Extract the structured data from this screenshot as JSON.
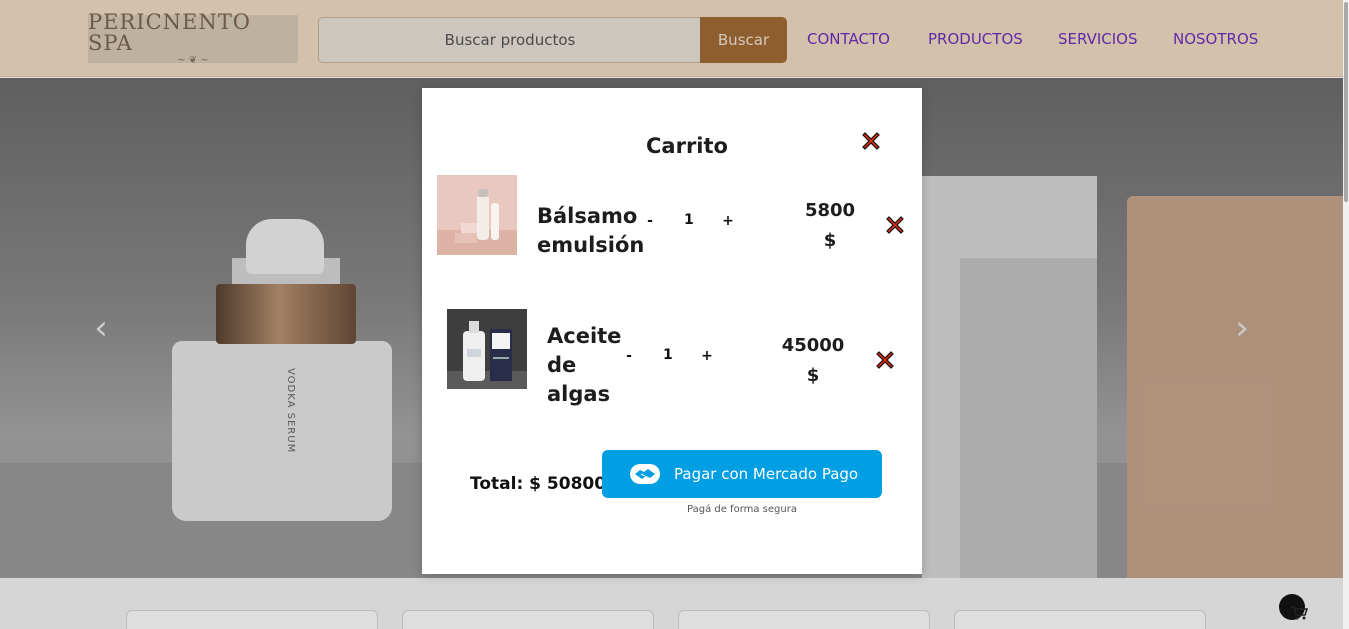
{
  "header": {
    "logo_text": "PERICNENTO SPA",
    "logo_flourish": "~ ❦ ~",
    "search": {
      "placeholder": "Buscar productos",
      "value": "",
      "button_label": "Buscar"
    },
    "nav": [
      {
        "label": "CONTACTO"
      },
      {
        "label": "PRODUCTOS"
      },
      {
        "label": "SERVICIOS"
      },
      {
        "label": "NOSOTROS"
      }
    ]
  },
  "hero": {
    "prev_label": "‹",
    "next_label": "›",
    "bottle_label": "VODKA SERUM"
  },
  "cart": {
    "title": "Carrito",
    "items": [
      {
        "name_lines": [
          "Bálsamo",
          "emulsión"
        ],
        "minus": "-",
        "quantity": "1",
        "plus": "+",
        "price_lines": [
          "5800",
          "$"
        ]
      },
      {
        "name_lines": [
          "Aceite",
          "de",
          "algas"
        ],
        "minus": "-",
        "quantity": "1",
        "plus": "+",
        "price_lines": [
          "45000",
          "$"
        ]
      }
    ],
    "total_label": "Total: $ 50800",
    "pay_button_label": "Pagar con Mercado Pago",
    "pay_secure_note": "Pagá de forma segura"
  },
  "colors": {
    "header_bg": "#f2dcc3",
    "nav_link": "#6f2fbf",
    "search_button_bg": "#a36b35",
    "mercado_pago_blue": "#009ee3",
    "remove_icon_red": "#d92b16"
  },
  "icons": {
    "close": "close-icon",
    "remove": "remove-item-icon",
    "pay": "handshake-icon",
    "cart": "cart-icon"
  }
}
